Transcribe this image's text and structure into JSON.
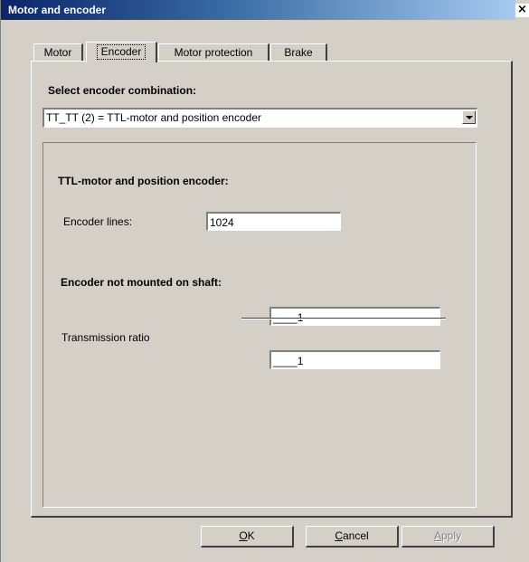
{
  "window": {
    "title": "Motor and encoder",
    "close_label": "×"
  },
  "tabs": [
    {
      "label": "Motor",
      "active": false
    },
    {
      "label": "Encoder",
      "active": true
    },
    {
      "label": "Motor protection",
      "active": false
    },
    {
      "label": "Brake",
      "active": false
    }
  ],
  "encoder": {
    "select_label": "Select encoder combination:",
    "selected_value": "TT_TT (2) = TTL-motor and position encoder",
    "group_title": "TTL-motor and position encoder:",
    "lines_label": "Encoder lines:",
    "lines_value": "1024",
    "not_mounted_title": "Encoder not mounted on shaft:",
    "ratio_label": "Transmission ratio",
    "ratio_numerator": "____1",
    "ratio_denominator": "____1"
  },
  "buttons": {
    "ok_mnemonic": "O",
    "ok_rest": "K",
    "cancel_mnemonic": "C",
    "cancel_rest": "ancel",
    "apply_mnemonic": "A",
    "apply_rest": "pply",
    "apply_enabled": false
  },
  "colors": {
    "dialog_bg": "#d4d0c8",
    "title_gradient_start": "#0a246a",
    "title_gradient_end": "#a6caf0"
  }
}
